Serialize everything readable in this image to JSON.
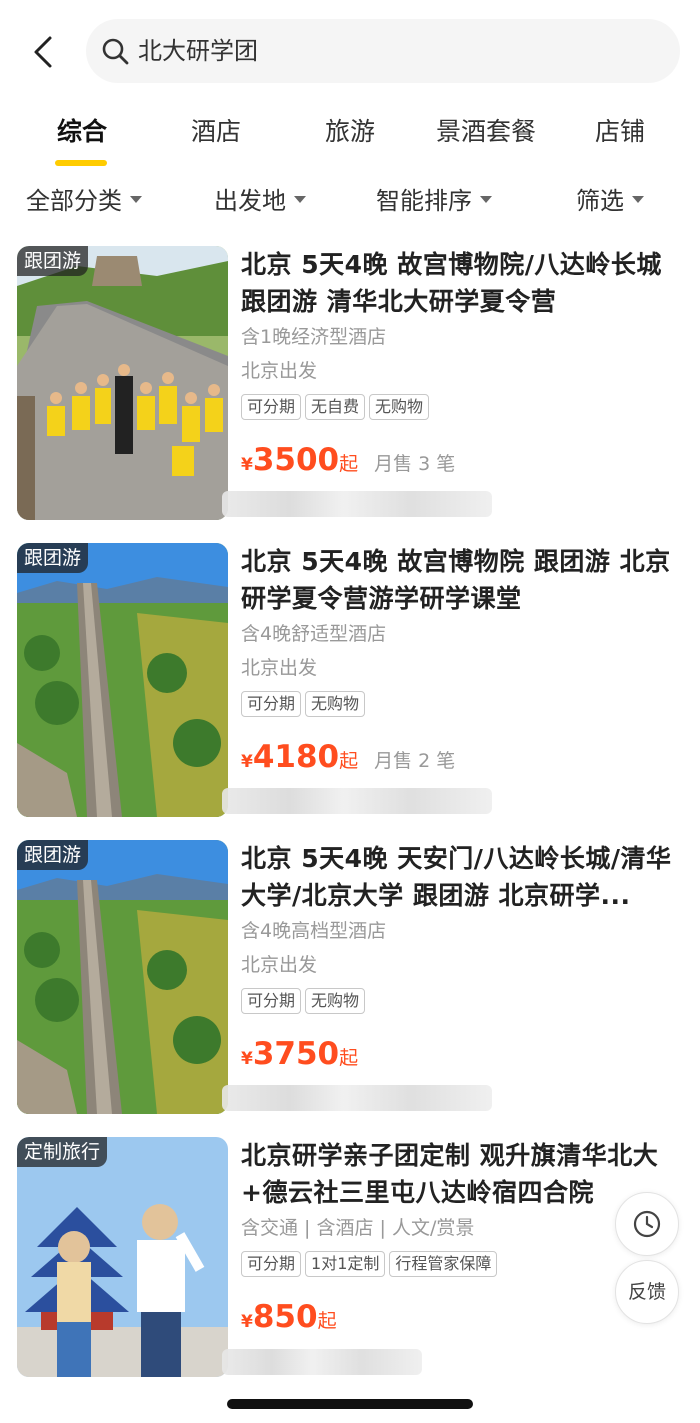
{
  "search": {
    "query": "北大研学团"
  },
  "tabs": [
    {
      "label": "综合",
      "active": true
    },
    {
      "label": "酒店"
    },
    {
      "label": "旅游"
    },
    {
      "label": "景酒套餐"
    },
    {
      "label": "店铺"
    }
  ],
  "filters": [
    {
      "label": "全部分类"
    },
    {
      "label": "出发地"
    },
    {
      "label": "智能排序"
    },
    {
      "label": "筛选"
    }
  ],
  "products": [
    {
      "badge": "跟团游",
      "title": "北京 5天4晚 故宫博物院/八达岭长城 跟团游 清华北大研学夏令营",
      "meta1": "含1晚经济型酒店",
      "meta2": "北京出发",
      "chips": [
        "可分期",
        "无自费",
        "无购物"
      ],
      "currency": "¥",
      "price": "3500",
      "price_suffix": "起",
      "sold": "月售 3 笔"
    },
    {
      "badge": "跟团游",
      "title": "北京 5天4晚 故宫博物院 跟团游 北京研学夏令营游学研学课堂",
      "meta1": "含4晚舒适型酒店",
      "meta2": "北京出发",
      "chips": [
        "可分期",
        "无购物"
      ],
      "currency": "¥",
      "price": "4180",
      "price_suffix": "起",
      "sold": "月售 2 笔"
    },
    {
      "badge": "跟团游",
      "title": "北京 5天4晚 天安门/八达岭长城/清华大学/北京大学 跟团游 北京研学...",
      "meta1": "含4晚高档型酒店",
      "meta2": "北京出发",
      "chips": [
        "可分期",
        "无购物"
      ],
      "currency": "¥",
      "price": "3750",
      "price_suffix": "起",
      "sold": ""
    },
    {
      "badge": "定制旅行",
      "title": "北京研学亲子团定制 观升旗清华北大+德云社三里屯八达岭宿四合院",
      "meta1": "含交通 | 含酒店 | 人文/赏景",
      "meta2": "",
      "chips": [
        "可分期",
        "1对1定制",
        "行程管家保障"
      ],
      "currency": "¥",
      "price": "850",
      "price_suffix": "起",
      "sold": ""
    }
  ],
  "floating": {
    "history_icon": "clock-icon",
    "feedback_label": "反馈"
  },
  "colors": {
    "accent": "#ffcc00",
    "price": "#ff4d1f"
  }
}
